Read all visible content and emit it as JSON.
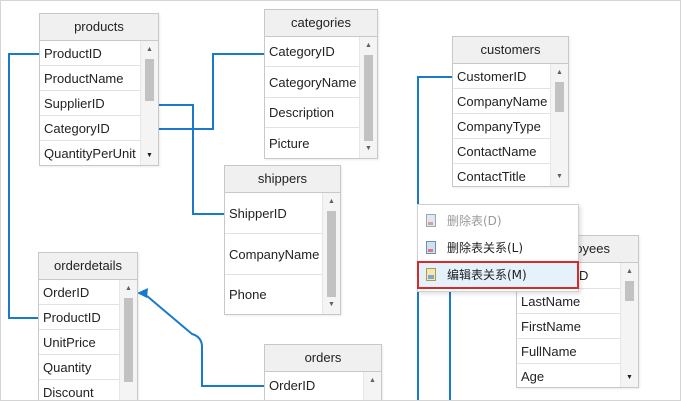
{
  "tables": {
    "products": {
      "title": "products",
      "fields": [
        "ProductID",
        "ProductName",
        "SupplierID",
        "CategoryID",
        "QuantityPerUnit"
      ]
    },
    "categories": {
      "title": "categories",
      "fields": [
        "CategoryID",
        "CategoryName",
        "Description",
        "Picture"
      ]
    },
    "customers": {
      "title": "customers",
      "fields": [
        "CustomerID",
        "CompanyName",
        "CompanyType",
        "ContactName",
        "ContactTitle"
      ]
    },
    "shippers": {
      "title": "shippers",
      "fields": [
        "ShipperID",
        "CompanyName",
        "Phone"
      ]
    },
    "orderdetails": {
      "title": "orderdetails",
      "fields": [
        "OrderID",
        "ProductID",
        "UnitPrice",
        "Quantity",
        "Discount"
      ]
    },
    "orders": {
      "title": "orders",
      "fields": [
        "OrderID"
      ]
    },
    "employees": {
      "title": "oyees",
      "fields": [
        "D",
        "LastName",
        "FirstName",
        "FullName",
        "Age"
      ]
    }
  },
  "context_menu": {
    "items": [
      {
        "label": "删除表(D)",
        "state": "disabled"
      },
      {
        "label": "删除表关系(L)",
        "state": "enabled"
      },
      {
        "label": "编辑表关系(M)",
        "state": "selected"
      }
    ]
  },
  "colors": {
    "relation_line": "#1a7ac8",
    "highlight_border": "#d62b2b",
    "header_bg": "#f0f0f0"
  },
  "icons": {
    "menu_item": "table-icon",
    "scroll_up": "triangle-up-icon",
    "scroll_down": "triangle-down-icon"
  }
}
